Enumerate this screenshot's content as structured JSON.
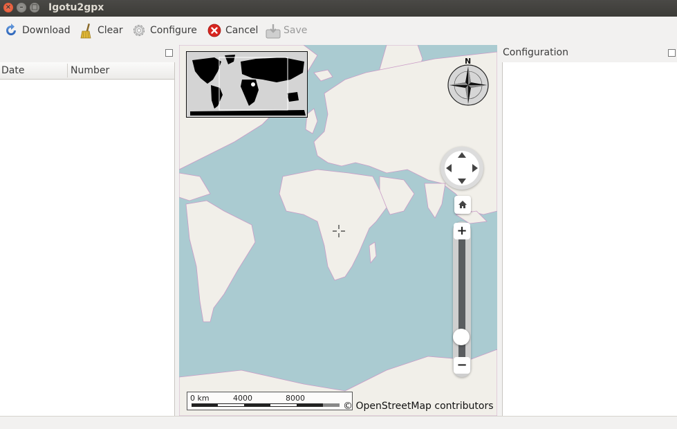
{
  "window": {
    "title": "Igotu2gpx"
  },
  "toolbar": {
    "download": "Download",
    "clear": "Clear",
    "configure": "Configure",
    "cancel": "Cancel",
    "save": "Save"
  },
  "tracks": {
    "columns": [
      "Date",
      "Number"
    ],
    "rows": []
  },
  "map": {
    "compass_label": "N",
    "scale": [
      "0 km",
      "4000",
      "8000"
    ],
    "attribution": "© OpenStreetMap contributors"
  },
  "configuration": {
    "title": "Configuration"
  },
  "colors": {
    "sea": "#aacbd1",
    "land": "#f1efe9",
    "borders": "#c99bc6",
    "titlebar": "#3c3b37"
  }
}
